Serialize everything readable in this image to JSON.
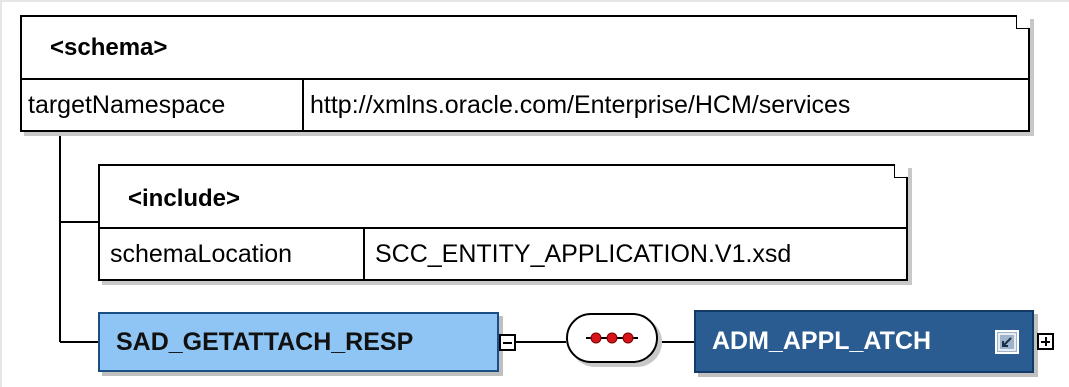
{
  "schema": {
    "tag": "<schema>",
    "attr_name": "targetNamespace",
    "attr_value": "http://xmlns.oracle.com/Enterprise/HCM/services"
  },
  "include": {
    "tag": "<include>",
    "attr_name": "schemaLocation",
    "attr_value": "SCC_ENTITY_APPLICATION.V1.xsd"
  },
  "root_element": {
    "name": "SAD_GETATTACH_RESP",
    "expanded": true
  },
  "compositor": {
    "kind": "sequence"
  },
  "child_element": {
    "name": "ADM_APPL_ATCH",
    "is_reference": true,
    "expanded": false
  },
  "colors": {
    "root_fill": "#8ec5f4",
    "child_fill": "#2a5c91",
    "dot_red": "#d8141b"
  }
}
